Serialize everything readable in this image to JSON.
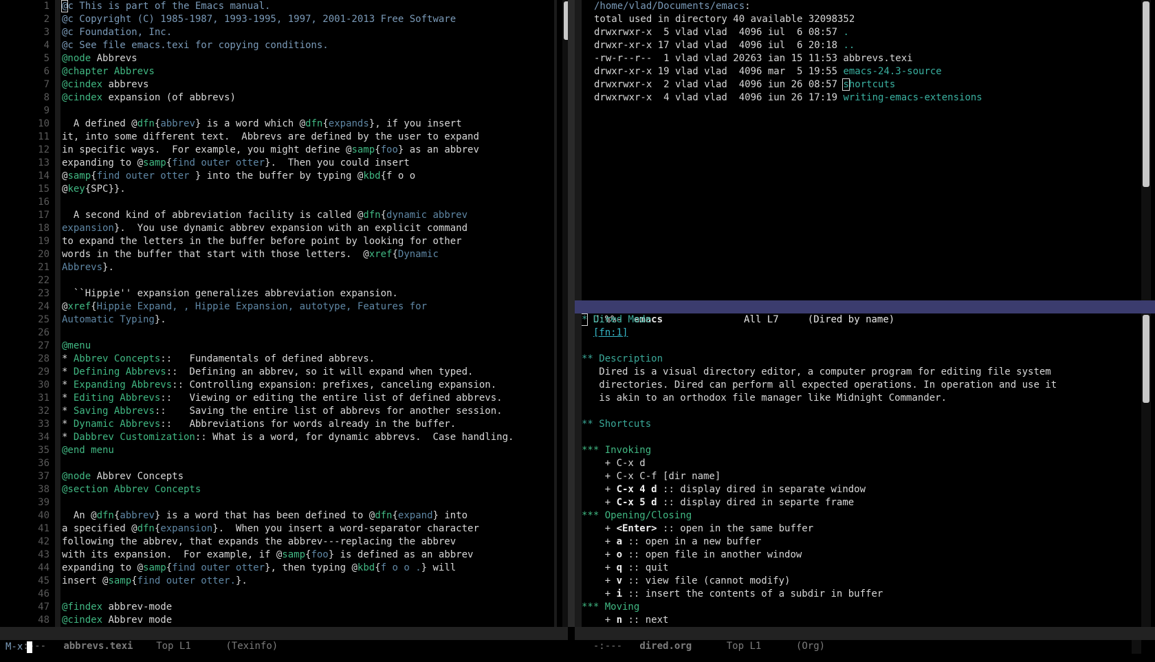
{
  "left_window": {
    "line_numbers": [
      "1",
      "2",
      "3",
      "4",
      "5",
      "6",
      "7",
      "8",
      "9",
      "10",
      "11",
      "12",
      "13",
      "14",
      "15",
      "16",
      "17",
      "18",
      "19",
      "20",
      "21",
      "22",
      "23",
      "24",
      "25",
      "26",
      "27",
      "28",
      "29",
      "30",
      "31",
      "32",
      "33",
      "34",
      "35",
      "36",
      "37",
      "38",
      "39",
      "40",
      "41",
      "42",
      "43",
      "44",
      "45",
      "46",
      "47",
      "48"
    ],
    "lines": [
      [
        {
          "t": "@",
          "c": "cursor-box c-cmt"
        },
        {
          "t": "c This is part of the Emacs manual.",
          "c": "c-cmt"
        }
      ],
      [
        {
          "t": "@c Copyright (C) 1985-1987, 1993-1995, 1997, 2001-2013 Free Software",
          "c": "c-cmt"
        }
      ],
      [
        {
          "t": "@c Foundation, Inc.",
          "c": "c-cmt"
        }
      ],
      [
        {
          "t": "@c See file emacs.texi for copying conditions.",
          "c": "c-cmt"
        }
      ],
      [
        {
          "t": "@node",
          "c": "c-kw"
        },
        {
          "t": " Abbrevs",
          "c": ""
        }
      ],
      [
        {
          "t": "@chapter Abbrevs",
          "c": "c-kw"
        }
      ],
      [
        {
          "t": "@cindex",
          "c": "c-kw"
        },
        {
          "t": " abbrevs",
          "c": ""
        }
      ],
      [
        {
          "t": "@cindex",
          "c": "c-kw"
        },
        {
          "t": " expansion (of abbrevs)",
          "c": ""
        }
      ],
      [],
      [
        {
          "t": "  A defined @",
          "c": ""
        },
        {
          "t": "dfn",
          "c": "c-kw"
        },
        {
          "t": "{",
          "c": ""
        },
        {
          "t": "abbrev",
          "c": "c-arg"
        },
        {
          "t": "} is a word which @",
          "c": ""
        },
        {
          "t": "dfn",
          "c": "c-kw"
        },
        {
          "t": "{",
          "c": ""
        },
        {
          "t": "expands",
          "c": "c-arg"
        },
        {
          "t": "}, if you insert",
          "c": ""
        }
      ],
      [
        {
          "t": "it, into some different text.  Abbrevs are defined by the user to expand",
          "c": ""
        }
      ],
      [
        {
          "t": "in specific ways.  For example, you might define @",
          "c": ""
        },
        {
          "t": "samp",
          "c": "c-kw"
        },
        {
          "t": "{",
          "c": ""
        },
        {
          "t": "foo",
          "c": "c-arg"
        },
        {
          "t": "} as an abbrev",
          "c": ""
        }
      ],
      [
        {
          "t": "expanding to @",
          "c": ""
        },
        {
          "t": "samp",
          "c": "c-kw"
        },
        {
          "t": "{",
          "c": ""
        },
        {
          "t": "find outer otter",
          "c": "c-arg"
        },
        {
          "t": "}.  Then you could insert",
          "c": ""
        }
      ],
      [
        {
          "t": "@",
          "c": ""
        },
        {
          "t": "samp",
          "c": "c-kw"
        },
        {
          "t": "{",
          "c": ""
        },
        {
          "t": "find outer otter ",
          "c": "c-arg"
        },
        {
          "t": "} into the buffer by typing @",
          "c": ""
        },
        {
          "t": "kbd",
          "c": "c-kw"
        },
        {
          "t": "{f o o",
          "c": ""
        }
      ],
      [
        {
          "t": "@",
          "c": ""
        },
        {
          "t": "key",
          "c": "c-kw"
        },
        {
          "t": "{SPC}}.",
          "c": ""
        }
      ],
      [],
      [
        {
          "t": "  A second kind of abbreviation facility is called @",
          "c": ""
        },
        {
          "t": "dfn",
          "c": "c-kw"
        },
        {
          "t": "{",
          "c": ""
        },
        {
          "t": "dynamic abbrev",
          "c": "c-arg"
        }
      ],
      [
        {
          "t": "expansion",
          "c": "c-arg"
        },
        {
          "t": "}.  You use dynamic abbrev expansion with an explicit command",
          "c": ""
        }
      ],
      [
        {
          "t": "to expand the letters in the buffer before point by looking for other",
          "c": ""
        }
      ],
      [
        {
          "t": "words in the buffer that start with those letters.  @",
          "c": ""
        },
        {
          "t": "xref",
          "c": "c-kw"
        },
        {
          "t": "{",
          "c": ""
        },
        {
          "t": "Dynamic",
          "c": "c-arg"
        }
      ],
      [
        {
          "t": "Abbrevs",
          "c": "c-arg"
        },
        {
          "t": "}.",
          "c": ""
        }
      ],
      [],
      [
        {
          "t": "  ``Hippie'' expansion generalizes abbreviation expansion.",
          "c": ""
        }
      ],
      [
        {
          "t": "@",
          "c": ""
        },
        {
          "t": "xref",
          "c": "c-kw"
        },
        {
          "t": "{",
          "c": ""
        },
        {
          "t": "Hippie Expand, , Hippie Expansion, autotype, Features for",
          "c": "c-arg"
        }
      ],
      [
        {
          "t": "Automatic Typing",
          "c": "c-arg"
        },
        {
          "t": "}.",
          "c": ""
        }
      ],
      [],
      [
        {
          "t": "@menu",
          "c": "c-kw"
        }
      ],
      [
        {
          "t": "* ",
          "c": ""
        },
        {
          "t": "Abbrev Concepts",
          "c": "c-kw"
        },
        {
          "t": "::   Fundamentals of defined abbrevs.",
          "c": ""
        }
      ],
      [
        {
          "t": "* ",
          "c": ""
        },
        {
          "t": "Defining Abbrevs",
          "c": "c-kw"
        },
        {
          "t": "::  Defining an abbrev, so it will expand when typed.",
          "c": ""
        }
      ],
      [
        {
          "t": "* ",
          "c": ""
        },
        {
          "t": "Expanding Abbrevs",
          "c": "c-kw"
        },
        {
          "t": ":: Controlling expansion: prefixes, canceling expansion.",
          "c": ""
        }
      ],
      [
        {
          "t": "* ",
          "c": ""
        },
        {
          "t": "Editing Abbrevs",
          "c": "c-kw"
        },
        {
          "t": "::   Viewing or editing the entire list of defined abbrevs.",
          "c": ""
        }
      ],
      [
        {
          "t": "* ",
          "c": ""
        },
        {
          "t": "Saving Abbrevs",
          "c": "c-kw"
        },
        {
          "t": "::    Saving the entire list of abbrevs for another session.",
          "c": ""
        }
      ],
      [
        {
          "t": "* ",
          "c": ""
        },
        {
          "t": "Dynamic Abbrevs",
          "c": "c-kw"
        },
        {
          "t": "::   Abbreviations for words already in the buffer.",
          "c": ""
        }
      ],
      [
        {
          "t": "* ",
          "c": ""
        },
        {
          "t": "Dabbrev Customization",
          "c": "c-kw"
        },
        {
          "t": ":: What is a word, for dynamic abbrevs.  Case handling.",
          "c": ""
        }
      ],
      [
        {
          "t": "@end menu",
          "c": "c-kw"
        }
      ],
      [],
      [
        {
          "t": "@node",
          "c": "c-kw"
        },
        {
          "t": " Abbrev Concepts",
          "c": ""
        }
      ],
      [
        {
          "t": "@section Abbrev Concepts",
          "c": "c-kw"
        }
      ],
      [],
      [
        {
          "t": "  An @",
          "c": ""
        },
        {
          "t": "dfn",
          "c": "c-kw"
        },
        {
          "t": "{",
          "c": ""
        },
        {
          "t": "abbrev",
          "c": "c-arg"
        },
        {
          "t": "} is a word that has been defined to @",
          "c": ""
        },
        {
          "t": "dfn",
          "c": "c-kw"
        },
        {
          "t": "{",
          "c": ""
        },
        {
          "t": "expand",
          "c": "c-arg"
        },
        {
          "t": "} into",
          "c": ""
        }
      ],
      [
        {
          "t": "a specified @",
          "c": ""
        },
        {
          "t": "dfn",
          "c": "c-kw"
        },
        {
          "t": "{",
          "c": ""
        },
        {
          "t": "expansion",
          "c": "c-arg"
        },
        {
          "t": "}.  When you insert a word-separator character",
          "c": ""
        }
      ],
      [
        {
          "t": "following the abbrev, that expands the abbrev---replacing the abbrev",
          "c": ""
        }
      ],
      [
        {
          "t": "with its expansion.  For example, if @",
          "c": ""
        },
        {
          "t": "samp",
          "c": "c-kw"
        },
        {
          "t": "{",
          "c": ""
        },
        {
          "t": "foo",
          "c": "c-arg"
        },
        {
          "t": "} is defined as an abbrev",
          "c": ""
        }
      ],
      [
        {
          "t": "expanding to @",
          "c": ""
        },
        {
          "t": "samp",
          "c": "c-kw"
        },
        {
          "t": "{",
          "c": ""
        },
        {
          "t": "find outer otter",
          "c": "c-arg"
        },
        {
          "t": "}, then typing @",
          "c": ""
        },
        {
          "t": "kbd",
          "c": "c-kw"
        },
        {
          "t": "{",
          "c": ""
        },
        {
          "t": "f o o .",
          "c": "c-arg"
        },
        {
          "t": "} will",
          "c": ""
        }
      ],
      [
        {
          "t": "insert @",
          "c": ""
        },
        {
          "t": "samp",
          "c": "c-kw"
        },
        {
          "t": "{",
          "c": ""
        },
        {
          "t": "find outer otter.",
          "c": "c-arg"
        },
        {
          "t": "}.",
          "c": ""
        }
      ],
      [],
      [
        {
          "t": "@findex",
          "c": "c-kw"
        },
        {
          "t": " abbrev-mode",
          "c": ""
        }
      ],
      [
        {
          "t": "@cindex",
          "c": "c-kw"
        },
        {
          "t": " Abbrev mode",
          "c": ""
        }
      ]
    ],
    "modeline": {
      "flags": "-:---",
      "buffer": "abbrevs.texi",
      "position": "Top L1",
      "mode": "(Texinfo)"
    }
  },
  "top_right_window": {
    "lines": [
      [
        {
          "t": "/home/vlad/Documents/emacs",
          "c": "c-dir"
        },
        {
          "t": ":",
          "c": ""
        }
      ],
      [
        {
          "t": "total used in directory 40 available 32098352",
          "c": ""
        }
      ],
      [
        {
          "t": "drwxrwxr-x  5 vlad vlad  4096 iul  6 08:57 ",
          "c": ""
        },
        {
          "t": ".",
          "c": "c-link"
        }
      ],
      [
        {
          "t": "drwxr-xr-x 17 vlad vlad  4096 iul  6 20:18 ",
          "c": ""
        },
        {
          "t": "..",
          "c": "c-link"
        }
      ],
      [
        {
          "t": "-rw-r--r--  1 vlad vlad 20263 ian 15 11:53 abbrevs.texi",
          "c": ""
        }
      ],
      [
        {
          "t": "drwxr-xr-x 19 vlad vlad  4096 mar  5 19:55 ",
          "c": ""
        },
        {
          "t": "emacs-24.3-source",
          "c": "c-link"
        }
      ],
      [
        {
          "t": "drwxrwxr-x  2 vlad vlad  4096 iun 26 08:57 ",
          "c": ""
        },
        {
          "t": "s",
          "c": "cursor-box c-link"
        },
        {
          "t": "hortcuts",
          "c": "c-link"
        }
      ],
      [
        {
          "t": "drwxrwxr-x  4 vlad vlad  4096 iun 26 17:19 ",
          "c": ""
        },
        {
          "t": "writing-emacs-extensions",
          "c": "c-link"
        }
      ]
    ],
    "modeline": {
      "flags": "U:%%-",
      "buffer": "emacs",
      "position": "All L7",
      "mode": "(Dired by name)"
    }
  },
  "bottom_right_window": {
    "lines": [
      [
        {
          "t": "*",
          "c": "cursor-box c-head"
        },
        {
          "t": " Dired Mode",
          "c": "c-head"
        }
      ],
      [
        {
          "t": "  ",
          "c": ""
        },
        {
          "t": "[fn:1]",
          "c": "c-fn"
        }
      ],
      [],
      [
        {
          "t": "** Description",
          "c": "c-head"
        }
      ],
      [
        {
          "t": "   Dired is a visual directory editor, a computer program for editing file system",
          "c": ""
        }
      ],
      [
        {
          "t": "   directories. Dired can perform all expected operations. In operation and use it",
          "c": ""
        }
      ],
      [
        {
          "t": "   is akin to an orthodox file manager like Midnight Commander.",
          "c": ""
        }
      ],
      [],
      [
        {
          "t": "** Shortcuts",
          "c": "c-head"
        }
      ],
      [],
      [
        {
          "t": "*** Invoking",
          "c": "c-kw"
        }
      ],
      [
        {
          "t": "    + C-x d",
          "c": ""
        }
      ],
      [
        {
          "t": "    + C-x C-f [dir name]",
          "c": ""
        }
      ],
      [
        {
          "t": "    + ",
          "c": ""
        },
        {
          "t": "C-x 4 d",
          "c": "c-b"
        },
        {
          "t": " :: display dired in separate window",
          "c": ""
        }
      ],
      [
        {
          "t": "    + ",
          "c": ""
        },
        {
          "t": "C-x 5 d",
          "c": "c-b"
        },
        {
          "t": " :: display dired in separte frame",
          "c": ""
        }
      ],
      [
        {
          "t": "*** Opening/Closing",
          "c": "c-kw"
        }
      ],
      [
        {
          "t": "    + ",
          "c": ""
        },
        {
          "t": "<Enter>",
          "c": "c-b"
        },
        {
          "t": " :: open in the same buffer",
          "c": ""
        }
      ],
      [
        {
          "t": "    + ",
          "c": ""
        },
        {
          "t": "a",
          "c": "c-b"
        },
        {
          "t": " :: open in a new buffer",
          "c": ""
        }
      ],
      [
        {
          "t": "    + ",
          "c": ""
        },
        {
          "t": "o",
          "c": "c-b"
        },
        {
          "t": " :: open file in another window",
          "c": ""
        }
      ],
      [
        {
          "t": "    + ",
          "c": ""
        },
        {
          "t": "q",
          "c": "c-b"
        },
        {
          "t": " :: quit",
          "c": ""
        }
      ],
      [
        {
          "t": "    + ",
          "c": ""
        },
        {
          "t": "v",
          "c": "c-b"
        },
        {
          "t": " :: view file (cannot modify)",
          "c": ""
        }
      ],
      [
        {
          "t": "    + ",
          "c": ""
        },
        {
          "t": "i",
          "c": "c-b"
        },
        {
          "t": " :: insert the contents of a subdir in buffer",
          "c": ""
        }
      ],
      [
        {
          "t": "*** Moving",
          "c": "c-kw"
        }
      ],
      [
        {
          "t": "    + ",
          "c": ""
        },
        {
          "t": "n",
          "c": "c-b"
        },
        {
          "t": " :: next",
          "c": ""
        }
      ]
    ],
    "modeline": {
      "flags": "-:---",
      "buffer": "dired.org",
      "position": "Top L1",
      "mode": "(Org)"
    }
  },
  "minibuffer": {
    "prompt": "M-x"
  }
}
